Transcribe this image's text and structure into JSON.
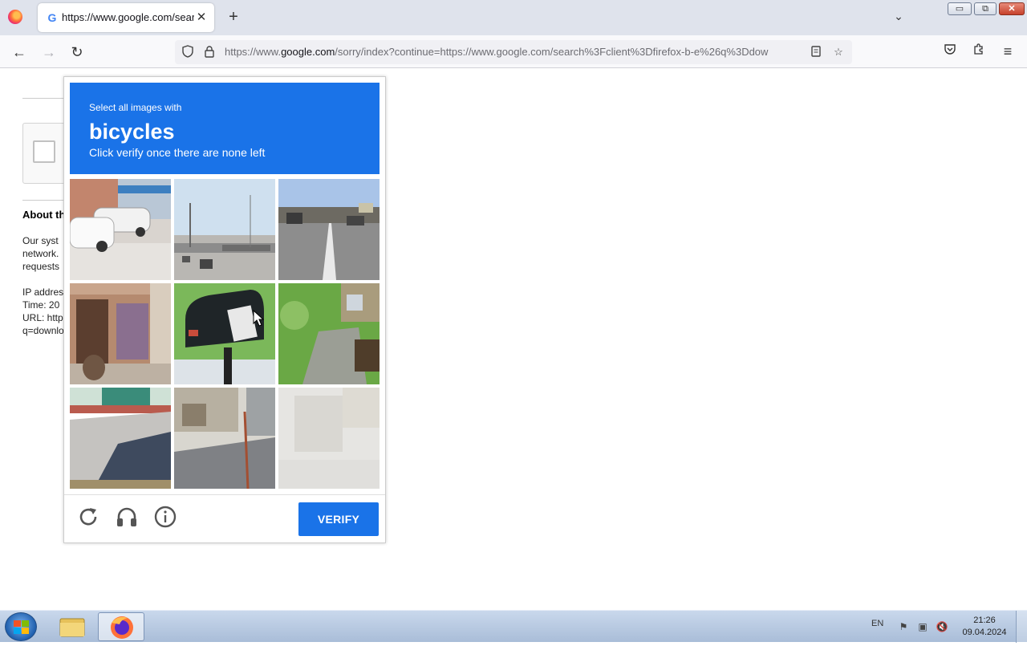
{
  "browser": {
    "tab": {
      "title": "https://www.google.com/search?",
      "favicon": "google-g-icon"
    },
    "url": {
      "host_prefix": "https://www.",
      "host": "google.com",
      "path": "/sorry/index?continue=https://www.google.com/search%3Fclient%3Dfirefox-b-e%26q%3Ddow"
    },
    "window_buttons": {
      "minimize": "▭",
      "maximize": "⧉",
      "close": "✕"
    }
  },
  "page": {
    "about_title": "About th",
    "lines": [
      "Our syst",
      "network.",
      "requests",
      "",
      "IP addres",
      "Time: 20",
      "URL: http",
      "q=downlo"
    ]
  },
  "captcha": {
    "instruction_top": "Select all images with",
    "target": "bicycles",
    "instruction_bottom": "Click verify once there are none left",
    "verify_label": "VERIFY",
    "icons": [
      "reload-icon",
      "headphones-icon",
      "info-icon"
    ],
    "colors": {
      "header": "#1a73e8",
      "button": "#1a73e8"
    }
  },
  "taskbar": {
    "language": "EN",
    "time": "21:26",
    "date": "09.04.2024"
  }
}
